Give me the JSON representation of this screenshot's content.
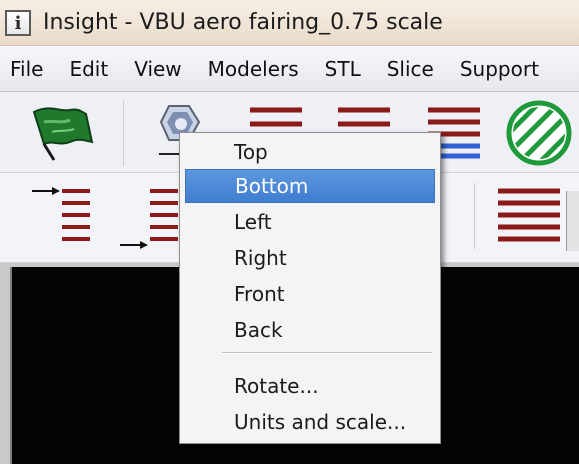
{
  "window": {
    "app_icon_text": "i",
    "title": "Insight - VBU aero fairing_0.75 scale"
  },
  "menubar": {
    "items": [
      {
        "label": "File"
      },
      {
        "label": "Edit"
      },
      {
        "label": "View"
      },
      {
        "label": "Modelers"
      },
      {
        "label": "STL"
      },
      {
        "label": "Slice"
      },
      {
        "label": "Support"
      }
    ]
  },
  "toolbar_icons": {
    "flag": "green-flag-icon",
    "view_cube": "view-orientation-icon",
    "lines": "stacked-lines-icon",
    "circle": "hatched-circle-icon",
    "arrow_lines": "arrow-stacked-lines-icon"
  },
  "context_menu": {
    "items": [
      {
        "label": "Top",
        "selected": false
      },
      {
        "label": "Bottom",
        "selected": true
      },
      {
        "label": "Left",
        "selected": false
      },
      {
        "label": "Right",
        "selected": false
      },
      {
        "label": "Front",
        "selected": false
      },
      {
        "label": "Back",
        "selected": false
      },
      {
        "label": "Rotate...",
        "selected": false
      },
      {
        "label": "Units and scale...",
        "selected": false
      }
    ]
  },
  "colors": {
    "menu_highlight": "#4a88d6",
    "dark_red_lines": "#8b1a1a",
    "icon_blue": "#2f62d6",
    "icon_green": "#1f7a2e",
    "viewport_background": "#040404"
  }
}
